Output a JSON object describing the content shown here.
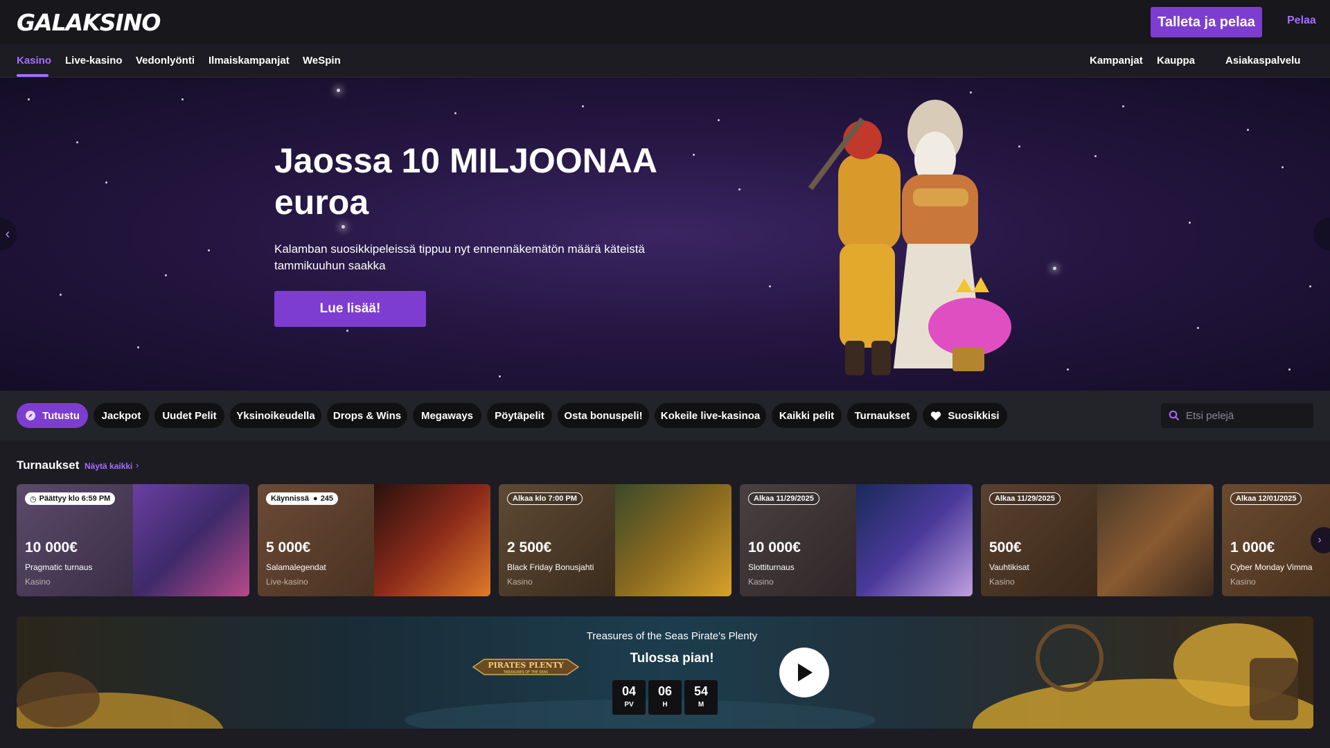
{
  "header": {
    "logo": "GALAKSINO",
    "deposit_button": "Talleta ja pelaa",
    "play_link": "Pelaa"
  },
  "nav": {
    "left": [
      "Kasino",
      "Live-kasino",
      "Vedonlyönti",
      "Ilmaiskampanjat",
      "WeSpin"
    ],
    "right": [
      "Kampanjat",
      "Kauppa",
      "Asiakaspalvelu"
    ],
    "active": "Kasino"
  },
  "hero": {
    "title": "Jaossa 10 MILJOONAA euroa",
    "description": "Kalamban suosikkipeleissä tippuu nyt ennennäkemätön määrä käteistä tammikuuhun saakka",
    "cta": "Lue lisää!",
    "prev_icon": "chevron-left-icon",
    "next_icon": "chevron-right-icon"
  },
  "categories": {
    "chips": [
      "Tutustu",
      "Jackpot",
      "Uudet Pelit",
      "Yksinoikeudella",
      "Drops & Wins",
      "Megaways",
      "Pöytäpelit",
      "Osta bonuspeli!",
      "Kokeile live-kasinoa",
      "Kaikki pelit",
      "Turnaukset",
      "Suosikkisi"
    ],
    "active": "Tutustu",
    "search_placeholder": "Etsi pelejä"
  },
  "tournaments": {
    "title": "Turnaukset",
    "see_all": "Näytä kaikki",
    "cards": [
      {
        "badge": "Päättyy klo 6:59 PM",
        "badge_icon": "clock-icon",
        "prize": "10 000€",
        "name": "Pragmatic turnaus",
        "category": "Kasino"
      },
      {
        "badge": "Käynnissä",
        "badge_count": "245",
        "badge_icon": "user-icon",
        "prize": "5 000€",
        "name": "Salamalegendat",
        "category": "Live-kasino"
      },
      {
        "badge": "Alkaa klo 7:00 PM",
        "prize": "2 500€",
        "name": "Black Friday Bonusjahti",
        "category": "Kasino"
      },
      {
        "badge": "Alkaa 11/29/2025",
        "prize": "10 000€",
        "name": "Slottiturnaus",
        "category": "Kasino"
      },
      {
        "badge": "Alkaa 11/29/2025",
        "prize": "500€",
        "name": "Vauhtikisat",
        "category": "Kasino"
      },
      {
        "badge": "Alkaa 12/01/2025",
        "prize": "1 000€",
        "name": "Cyber Monday Vimma",
        "category": "Kasino"
      }
    ]
  },
  "upcoming": {
    "game": "Treasures of the Seas Pirate's Plenty",
    "status": "Tulossa pian!",
    "logo_text": "PIRATES PLENTY",
    "logo_sub": "TREASURES OF THE SEAS",
    "countdown": [
      {
        "value": "04",
        "unit": "PV"
      },
      {
        "value": "06",
        "unit": "H"
      },
      {
        "value": "54",
        "unit": "M"
      }
    ]
  },
  "colors": {
    "accent": "#7d3dd0",
    "accent_text": "#a56eff",
    "header_bg": "#17171c",
    "page_bg": "#1c1c22"
  }
}
